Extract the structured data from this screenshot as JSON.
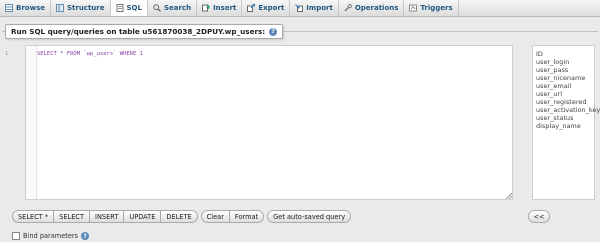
{
  "tabs": [
    {
      "label": "Browse",
      "icon": "browse-icon"
    },
    {
      "label": "Structure",
      "icon": "structure-icon"
    },
    {
      "label": "SQL",
      "icon": "sql-icon"
    },
    {
      "label": "Search",
      "icon": "search-icon"
    },
    {
      "label": "Insert",
      "icon": "insert-icon"
    },
    {
      "label": "Export",
      "icon": "export-icon"
    },
    {
      "label": "Import",
      "icon": "import-icon"
    },
    {
      "label": "Operations",
      "icon": "operations-icon"
    },
    {
      "label": "Triggers",
      "icon": "triggers-icon"
    }
  ],
  "active_tab": "SQL",
  "legend": "Run SQL query/queries on table u561870038_2DPUY.wp_users:",
  "editor": {
    "line_number": "1",
    "query": "SELECT * FROM `wp_users` WHERE 1"
  },
  "columns": [
    "ID",
    "user_login",
    "user_pass",
    "user_nicename",
    "user_email",
    "user_url",
    "user_registered",
    "user_activation_key",
    "user_status",
    "display_name"
  ],
  "buttons": {
    "query_group": [
      "SELECT *",
      "SELECT",
      "INSERT",
      "UPDATE",
      "DELETE"
    ],
    "clear": "Clear",
    "format": "Format",
    "auto_saved": "Get auto-saved query",
    "insert_column": "<<"
  },
  "bind_parameters": "Bind parameters",
  "colors": {
    "tab_text": "#235a81",
    "code": "#8b3fa7",
    "help": "#5b88b5"
  }
}
